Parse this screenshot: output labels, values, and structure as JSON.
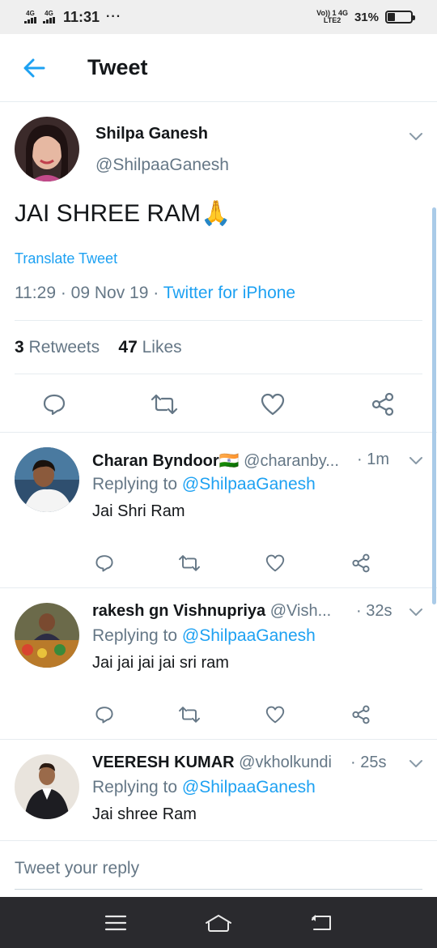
{
  "status_bar": {
    "signal1": "4G",
    "signal2": "4G",
    "time": "11:31",
    "dots": "···",
    "network_top": "Vo)) 1 4G",
    "network_bottom": "LTE2",
    "battery_percent": "31%",
    "battery_level": 0.31
  },
  "header": {
    "back_icon": "arrow-left-icon",
    "title": "Tweet"
  },
  "tweet": {
    "author_name": "Shilpa Ganesh",
    "author_handle": "@ShilpaaGanesh",
    "text": "JAI SHREE RAM",
    "emoji": "🙏",
    "translate_label": "Translate Tweet",
    "time": "11:29",
    "date": "09 Nov 19",
    "source": "Twitter for iPhone",
    "retweets_count": "3",
    "retweets_label": "Retweets",
    "likes_count": "47",
    "likes_label": "Likes"
  },
  "replies": [
    {
      "name": "Charan Byndoor",
      "flag": "🇮🇳",
      "handle": "@charanby...",
      "time": "· 1m",
      "replying_prefix": "Replying to",
      "replying_to": "@ShilpaaGanesh",
      "text": "Jai Shri Ram"
    },
    {
      "name": "rakesh gn Vishnupriya",
      "handle": "@Vish...",
      "time": "· 32s",
      "replying_prefix": "Replying to",
      "replying_to": "@ShilpaaGanesh",
      "text": "Jai jai jai jai sri ram"
    },
    {
      "name": "VEERESH KUMAR",
      "handle": "@vkholkundi",
      "time": "· 25s",
      "replying_prefix": "Replying to",
      "replying_to": "@ShilpaaGanesh",
      "text": "Jai shree Ram"
    }
  ],
  "composer": {
    "placeholder": "Tweet your reply"
  },
  "colors": {
    "accent": "#1da1f2",
    "secondary_text": "#657786",
    "primary_text": "#14171a",
    "divider": "#e6ecf0",
    "navbar": "#2a2a2e"
  },
  "icons": {
    "reply": "reply-icon",
    "retweet": "retweet-icon",
    "like": "heart-icon",
    "share": "share-icon",
    "menu": "chevron-down-icon",
    "nav_menu": "menu-icon",
    "nav_home": "home-icon",
    "nav_back": "back-icon"
  }
}
